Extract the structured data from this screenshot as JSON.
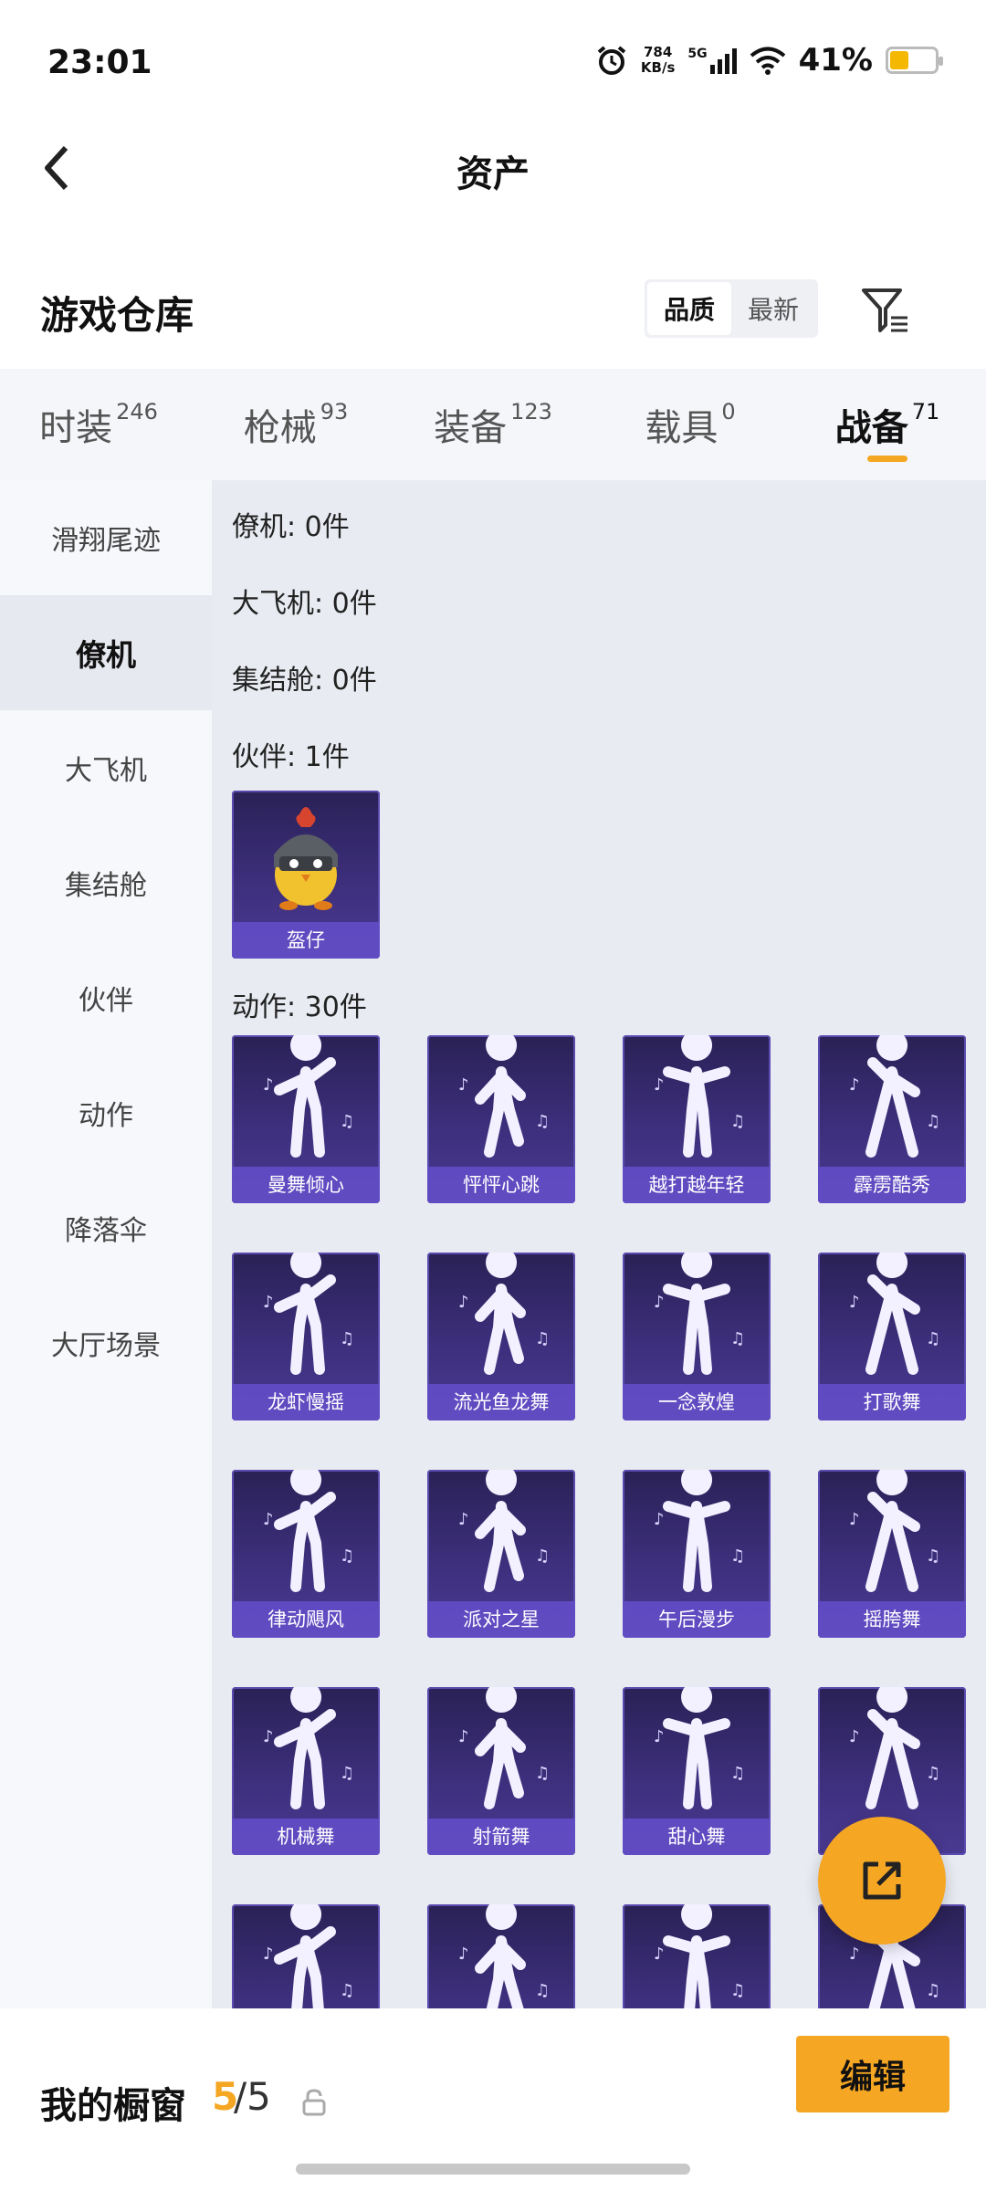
{
  "status_bar": {
    "time": "23:01",
    "net_speed_value": "784",
    "net_speed_unit": "KB/s",
    "network": "5G",
    "battery": "41%",
    "battery_level": 0.41
  },
  "header": {
    "title": "资产"
  },
  "warehouse": {
    "title": "游戏仓库",
    "sort_options": [
      "品质",
      "最新"
    ],
    "active_sort": "品质"
  },
  "tabs": [
    {
      "label": "时装",
      "count": "246"
    },
    {
      "label": "枪械",
      "count": "93"
    },
    {
      "label": "装备",
      "count": "123"
    },
    {
      "label": "载具",
      "count": "0"
    },
    {
      "label": "战备",
      "count": "71",
      "active": true
    }
  ],
  "sidebar": {
    "items": [
      "滑翔尾迹",
      "僚机",
      "大飞机",
      "集结舱",
      "伙伴",
      "动作",
      "降落伞",
      "大厅场景"
    ],
    "active": "僚机"
  },
  "sections": {
    "wingman": "僚机: 0件",
    "big_plane": "大飞机: 0件",
    "rally_pod": "集结舱: 0件",
    "companion": "伙伴: 1件",
    "emote": "动作: 30件"
  },
  "companion_items": [
    "盔仔"
  ],
  "emote_items": [
    "曼舞倾心",
    "怦怦心跳",
    "越打越年轻",
    "霹雳酷秀",
    "龙虾慢摇",
    "流光鱼龙舞",
    "一念敦煌",
    "打歌舞",
    "律动飓风",
    "派对之星",
    "午后漫步",
    "摇胯舞",
    "机械舞",
    "射箭舞",
    "甜心舞",
    "",
    "",
    "",
    "",
    ""
  ],
  "bottom_bar": {
    "label": "我的橱窗",
    "count_current": "5",
    "count_rest": "/5",
    "edit_label": "编辑"
  },
  "colors": {
    "accent": "#f5a623",
    "card_bg": "#3d2f7c",
    "card_label": "#624cc4"
  }
}
